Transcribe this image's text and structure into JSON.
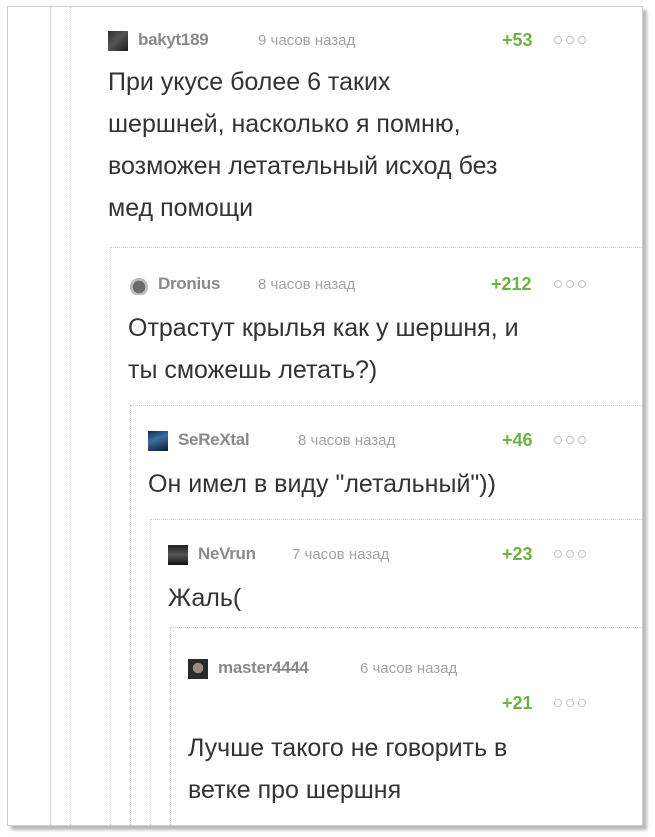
{
  "comments": [
    {
      "username": "bakyt189",
      "time": "9 часов назад",
      "rating": "+53",
      "lines": [
        "При укусе более 6 таких",
        "шершней, насколько я помню,",
        "возможен летательный исход без",
        "мед помощи"
      ]
    },
    {
      "username": "Dronius",
      "time": "8 часов назад",
      "rating": "+212",
      "lines": [
        "Отрастут крылья как у шершня, и",
        "ты сможешь летать?)"
      ]
    },
    {
      "username": "SeReXtal",
      "time": "8 часов назад",
      "rating": "+46",
      "lines": [
        "Он имел в виду \"летальный\"))"
      ]
    },
    {
      "username": "NeVrun",
      "time": "7 часов назад",
      "rating": "+23",
      "lines": [
        "Жаль("
      ]
    },
    {
      "username": "master4444",
      "time": "6 часов назад",
      "rating": "+21",
      "lines": [
        "Лучше такого не говорить в",
        "ветке про шершня"
      ]
    }
  ],
  "colors": {
    "rating": "#6fb244",
    "username": "#8a8a8a",
    "time": "#a3a3a3",
    "text": "#333333"
  },
  "icons": [
    "user-avatar",
    "more-options-icon"
  ]
}
